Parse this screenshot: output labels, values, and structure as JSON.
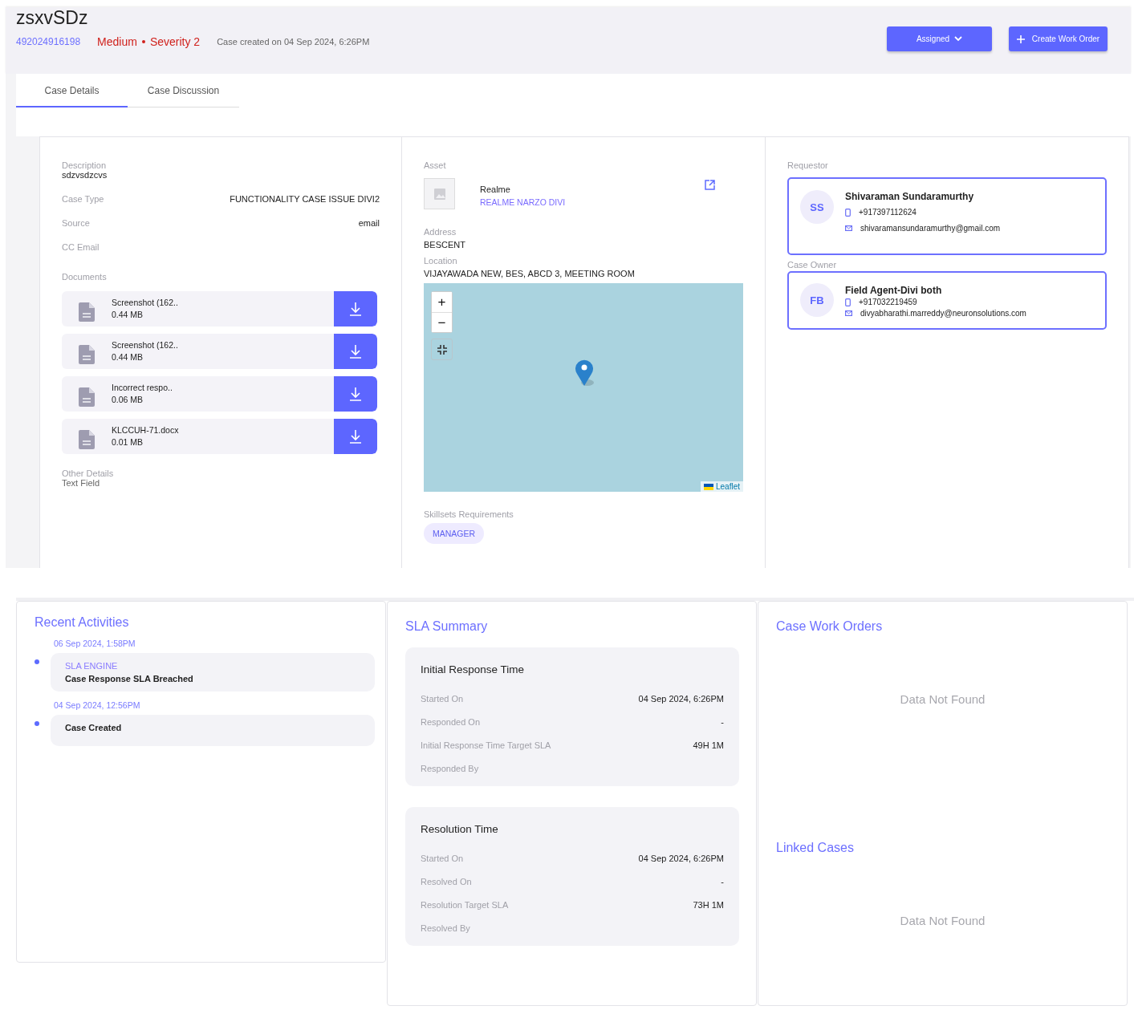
{
  "case": {
    "title": "zsxvSDz",
    "number": "492024916198",
    "priority": "Medium",
    "severity": "Severity 2",
    "created": "Case created on 04 Sep 2024, 6:26PM"
  },
  "actions": [
    {
      "label": "Assigned",
      "kind": "dropdown"
    },
    {
      "label": "Create Work Order",
      "kind": "add"
    }
  ],
  "tabs": [
    {
      "label": "Case Details",
      "selected": true
    },
    {
      "label": "Case Discussion",
      "selected": false
    }
  ],
  "details": {
    "description_label": "Description",
    "description": "sdzvsdzcvs",
    "fields": [
      {
        "label": "Case Type",
        "value": "FUNCTIONALITY CASE ISSUE DIVI2"
      },
      {
        "label": "Source",
        "value": "email"
      },
      {
        "label": "CC Email"
      }
    ],
    "documents_label": "Documents",
    "documents": [
      {
        "name": "Screenshot (162..",
        "size": "0.44 MB"
      },
      {
        "name": "Screenshot (162..",
        "size": "0.44 MB"
      },
      {
        "name": "Incorrect respo..",
        "size": "0.06 MB"
      },
      {
        "name": "KLCCUH-71.docx",
        "size": "0.01 MB"
      }
    ],
    "other_label": "Other Details",
    "other_value": "Text Field"
  },
  "asset": {
    "label": "Asset",
    "name": "Realme",
    "model": "REALME NARZO DIVI",
    "address_label": "Address",
    "address": "BESCENT",
    "location_label": "Location",
    "location": "VIJAYAWADA NEW, BES, ABCD 3, MEETING ROOM",
    "map": {
      "zoom_in": "+",
      "zoom_out": "−",
      "attribution": "Leaflet"
    },
    "skills_label": "Skillsets Requirements",
    "skills": [
      "MANAGER"
    ]
  },
  "contacts": [
    {
      "role": "Requestor",
      "initials": "SS",
      "name": "Shivaraman Sundaramurthy",
      "phone": "+917397112624",
      "email": "shivaramansundaramurthy@gmail.com"
    },
    {
      "role": "Case Owner",
      "initials": "FB",
      "name": "Field Agent-Divi both",
      "phone": "+917032219459",
      "email": "divyabharathi.marreddy@neuronsolutions.com"
    }
  ],
  "activities": {
    "title": "Recent Activities",
    "items": [
      {
        "time": "06 Sep 2024, 1:58PM",
        "source": "SLA ENGINE",
        "text": "Case Response SLA Breached"
      },
      {
        "time": "04 Sep 2024, 12:56PM",
        "text": "Case Created"
      }
    ]
  },
  "sla": {
    "title": "SLA Summary",
    "sections": [
      {
        "title": "Initial Response Time",
        "rows": [
          {
            "label": "Started On",
            "value": "04 Sep 2024, 6:26PM"
          },
          {
            "label": "Responded On",
            "value": "-"
          },
          {
            "label": "Initial Response Time Target SLA",
            "value": "49H 1M"
          },
          {
            "label": "Responded By"
          }
        ]
      },
      {
        "title": "Resolution Time",
        "rows": [
          {
            "label": "Started On",
            "value": "04 Sep 2024, 6:26PM"
          },
          {
            "label": "Resolved On",
            "value": "-"
          },
          {
            "label": "Resolution Target SLA",
            "value": "73H 1M"
          },
          {
            "label": "Resolved By"
          }
        ]
      }
    ]
  },
  "work_orders": {
    "title": "Case Work Orders",
    "empty": "Data Not Found"
  },
  "linked_cases": {
    "title": "Linked Cases",
    "empty": "Data Not Found"
  }
}
